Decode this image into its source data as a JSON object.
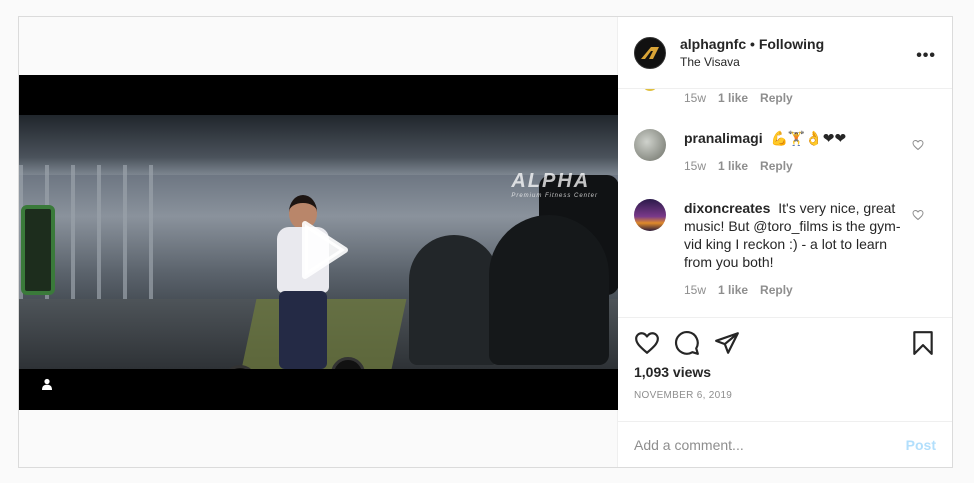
{
  "header": {
    "username": "alphagnfc",
    "separator": "•",
    "follow_status": "Following",
    "location": "The Visava",
    "more_icon": "more-horizontal-icon"
  },
  "video": {
    "watermark": "ALPHA",
    "watermark_sub": "Premium Fitness Center",
    "play_icon": "play-icon",
    "user_tag_icon": "user-icon"
  },
  "comments": {
    "partial": {
      "time": "15w",
      "likes": "1 like",
      "reply": "Reply"
    },
    "items": [
      {
        "username": "pranalimagi",
        "text": "💪🏋👌❤❤",
        "time": "15w",
        "likes": "1 like",
        "reply": "Reply"
      },
      {
        "username": "dixoncreates",
        "text": "It's very nice, great music! But @toro_films is the gym-vid king I reckon :) - a lot to learn from you both!",
        "time": "15w",
        "likes": "1 like",
        "reply": "Reply"
      }
    ]
  },
  "actions": {
    "like_icon": "heart-icon",
    "comment_icon": "comment-icon",
    "share_icon": "share-icon",
    "save_icon": "bookmark-icon",
    "views": "1,093 views",
    "date": "NOVEMBER 6, 2019"
  },
  "add_comment": {
    "placeholder": "Add a comment...",
    "post_label": "Post",
    "post_color": "#b2dffc"
  }
}
